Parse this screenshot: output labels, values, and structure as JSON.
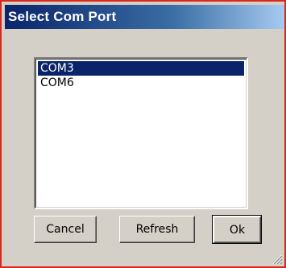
{
  "window": {
    "title": "Select Com Port"
  },
  "ports": {
    "items": [
      "COM3",
      "COM6"
    ],
    "selected": "COM3"
  },
  "buttons": {
    "cancel": "Cancel",
    "refresh": "Refresh",
    "ok": "Ok"
  },
  "colors": {
    "title_start": "#0a246a",
    "title_end": "#a6caf0",
    "selection": "#0a246a",
    "window_border": "#d9281c",
    "face": "#d4d0c8"
  }
}
